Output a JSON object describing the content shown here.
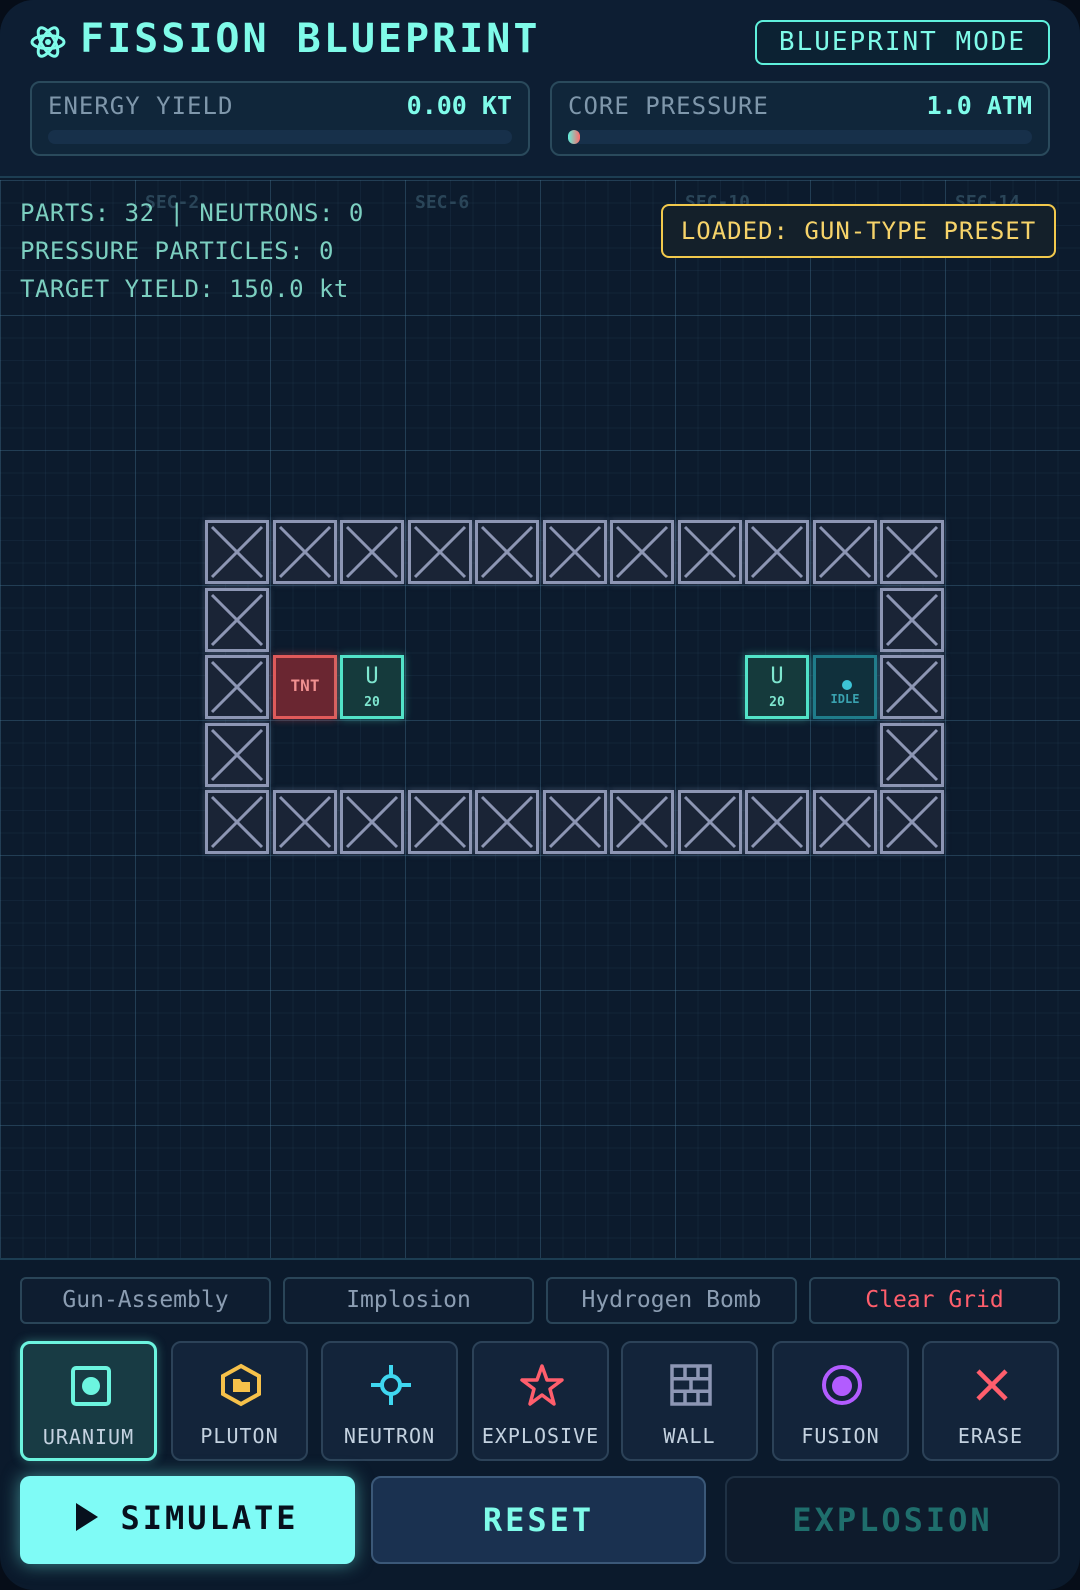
{
  "header": {
    "title": "FISSION BLUEPRINT",
    "mode_badge": "BLUEPRINT MODE",
    "energy": {
      "label": "ENERGY YIELD",
      "value": "0.00 KT",
      "fill": 0.0
    },
    "pressure": {
      "label": "CORE PRESSURE",
      "value": "1.0 ATM",
      "fill": 0.02
    }
  },
  "grid": {
    "sector_labels": [
      "SEC-2",
      "SEC-6",
      "SEC-10",
      "SEC-14"
    ],
    "stats": {
      "line1": "PARTS: 32 | NEUTRONS: 0",
      "line2": "PRESSURE PARTICLES: 0",
      "line3": "TARGET YIELD: 150.0 kt"
    },
    "loaded_badge": "LOADED: GUN-TYPE PRESET",
    "tnt_label": "TNT",
    "uranium_symbol": "U",
    "uranium_count": "20",
    "neutron_state": "IDLE"
  },
  "presets": [
    "Gun-Assembly",
    "Implosion",
    "Hydrogen Bomb",
    "Clear Grid"
  ],
  "tools": [
    {
      "label": "URANIUM",
      "icon": "uranium-icon",
      "active": true
    },
    {
      "label": "PLUTON",
      "icon": "plutonium-icon",
      "active": false
    },
    {
      "label": "NEUTRON",
      "icon": "neutron-icon",
      "active": false
    },
    {
      "label": "EXPLOSIVE",
      "icon": "explosive-star-icon",
      "active": false
    },
    {
      "label": "WALL",
      "icon": "wall-brick-icon",
      "active": false
    },
    {
      "label": "FUSION",
      "icon": "fusion-icon",
      "active": false
    },
    {
      "label": "ERASE",
      "icon": "erase-x-icon",
      "active": false
    }
  ],
  "actions": {
    "simulate": "SIMULATE",
    "reset": "RESET",
    "explosion": "EXPLOSION"
  },
  "colors": {
    "accent": "#7ffbe9",
    "warning": "#f2c94c",
    "danger": "#ff5e6c",
    "wall": "#8d96b4"
  }
}
